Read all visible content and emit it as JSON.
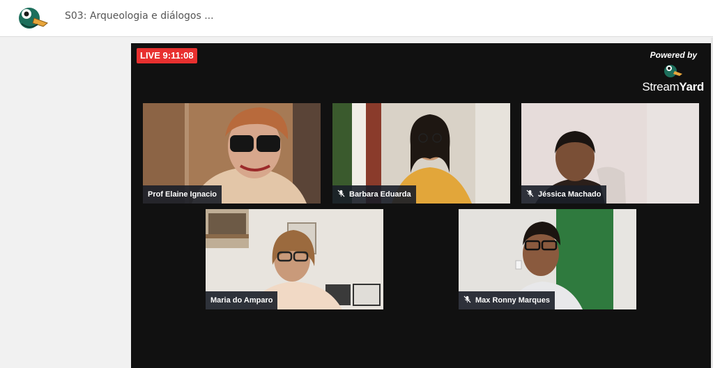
{
  "header": {
    "title": "S03: Arqueologia e diálogos ..."
  },
  "stage": {
    "live_label": "LIVE 9:11:08",
    "powered_by": "Powered by",
    "brand_part1": "Stream",
    "brand_part2": "Yard"
  },
  "participants": [
    {
      "name": "Prof Elaine Ignacio",
      "muted": false
    },
    {
      "name": "Barbara Eduarda",
      "muted": true
    },
    {
      "name": "Jéssica Machado",
      "muted": true
    },
    {
      "name": "Maria do Amparo",
      "muted": false
    },
    {
      "name": "Max Ronny Marques",
      "muted": true
    }
  ],
  "colors": {
    "live_badge": "#e8302f",
    "stage_bg": "#111111",
    "nametag_bg": "#191e28"
  },
  "icons": {
    "app_logo": "duck-logo-icon",
    "streamyard_logo": "duck-logo-icon",
    "muted": "mic-off-icon"
  }
}
